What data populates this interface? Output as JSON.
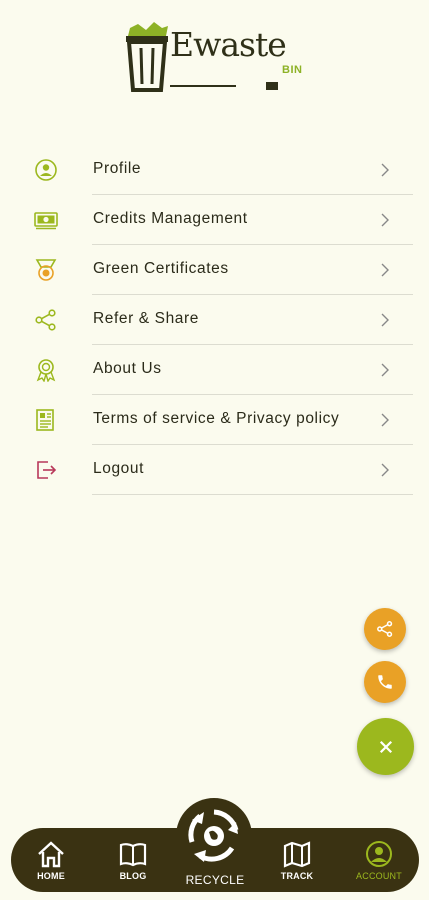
{
  "logo": {
    "text": "Ewaste",
    "sub": "BIN",
    "icon": "trash-bin-logo"
  },
  "menu": [
    {
      "label": "Profile",
      "icon": "profile-icon"
    },
    {
      "label": "Credits Management",
      "icon": "credits-icon"
    },
    {
      "label": "Green Certificates",
      "icon": "medal-icon"
    },
    {
      "label": "Refer & Share",
      "icon": "share-icon"
    },
    {
      "label": "About Us",
      "icon": "award-icon"
    },
    {
      "label": "Terms of service & Privacy policy",
      "icon": "document-icon"
    },
    {
      "label": "Logout",
      "icon": "logout-icon"
    }
  ],
  "fabs": {
    "share": "share-icon",
    "call": "phone-icon",
    "close": "close-icon"
  },
  "nav": {
    "home": "HOME",
    "blog": "BLOG",
    "recycle": "RECYCLE",
    "track": "TRACK",
    "account": "ACCOUNT"
  },
  "colors": {
    "background": "#fbfbee",
    "accent_green": "#9cb81e",
    "accent_orange": "#e9a126",
    "nav_bg": "#3a3212",
    "logout_red": "#b8385a"
  }
}
